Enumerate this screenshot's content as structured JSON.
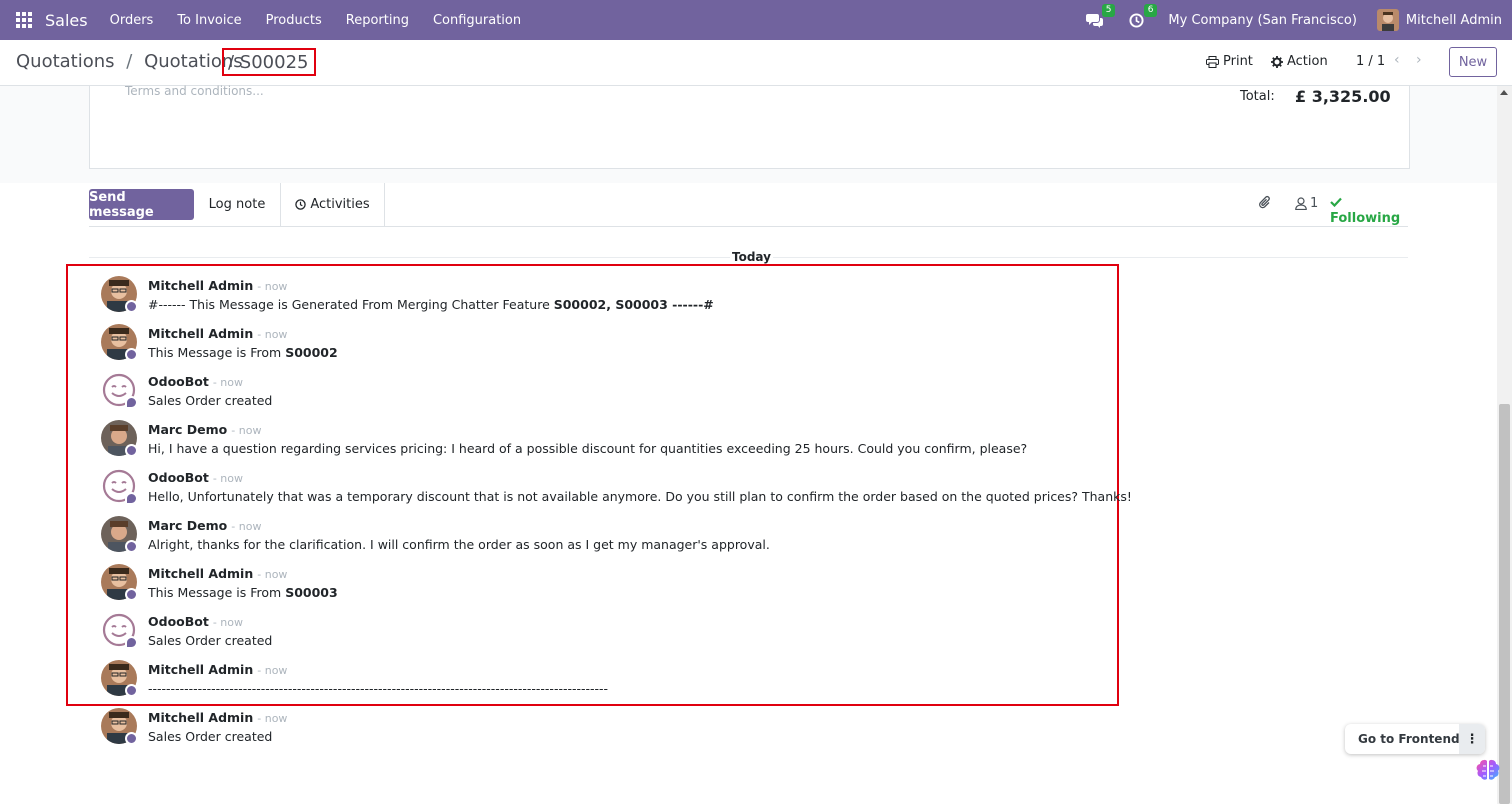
{
  "navbar": {
    "app_name": "Sales",
    "menu": [
      "Orders",
      "To Invoice",
      "Products",
      "Reporting",
      "Configuration"
    ],
    "messages_count": "5",
    "activities_count": "6",
    "company": "My Company (San Francisco)",
    "user": "Mitchell Admin",
    "bg_color": "#71639e"
  },
  "control": {
    "breadcrumb": [
      "Quotations",
      "Quotations"
    ],
    "separator": "/",
    "current": "/ S00025",
    "print": "Print",
    "action": "Action",
    "pager": "1 / 1",
    "new": "New"
  },
  "form": {
    "terms_placeholder": "Terms and conditions...",
    "total_label": "Total:",
    "total_value": "£ 3,325.00"
  },
  "chatter": {
    "send_message": "Send message",
    "log_note": "Log note",
    "activities": "Activities",
    "followers_count": "1",
    "following": "Following",
    "date_separator": "Today",
    "messages": [
      {
        "author": "Mitchell Admin",
        "date": "- now",
        "type": "admin",
        "body_pre": "#------ This Message is Generated From Merging Chatter Feature ",
        "body_bold": "S00002, S00003 ------#",
        "body_post": ""
      },
      {
        "author": "Mitchell Admin",
        "date": "- now",
        "type": "admin",
        "body_pre": "This Message is From ",
        "body_bold": "S00002",
        "body_post": ""
      },
      {
        "author": "OdooBot",
        "date": "- now",
        "type": "bot",
        "body_pre": "Sales Order created",
        "body_bold": "",
        "body_post": ""
      },
      {
        "author": "Marc Demo",
        "date": "- now",
        "type": "demo",
        "body_pre": "Hi, I have a question regarding services pricing: I heard of a possible discount for quantities exceeding 25 hours. Could you confirm, please?",
        "body_bold": "",
        "body_post": ""
      },
      {
        "author": "OdooBot",
        "date": "- now",
        "type": "bot",
        "body_pre": "Hello, Unfortunately that was a temporary discount that is not available anymore. Do you still plan to confirm the order based on the quoted prices? Thanks!",
        "body_bold": "",
        "body_post": ""
      },
      {
        "author": "Marc Demo",
        "date": "- now",
        "type": "demo",
        "body_pre": "Alright, thanks for the clarification. I will confirm the order as soon as I get my manager's approval.",
        "body_bold": "",
        "body_post": ""
      },
      {
        "author": "Mitchell Admin",
        "date": "- now",
        "type": "admin",
        "body_pre": "This Message is From ",
        "body_bold": "S00003",
        "body_post": ""
      },
      {
        "author": "OdooBot",
        "date": "- now",
        "type": "bot",
        "body_pre": "Sales Order created",
        "body_bold": "",
        "body_post": ""
      },
      {
        "author": "Mitchell Admin",
        "date": "- now",
        "type": "admin",
        "body_pre": "------------------------------------------------------------------------------------------------------",
        "body_bold": "",
        "body_post": ""
      },
      {
        "author": "Mitchell Admin",
        "date": "- now",
        "type": "admin",
        "body_pre": "Sales Order created",
        "body_bold": "",
        "body_post": ""
      }
    ]
  },
  "frontend": {
    "label": "Go to Frontend",
    "more": "⋮"
  },
  "icons": {
    "apps": "apps-grid-icon",
    "chat": "chat-icon",
    "clock": "clock-icon",
    "print": "printer-icon",
    "gear": "gear-icon",
    "paperclip": "paperclip-icon",
    "user": "user-icon",
    "check": "check-icon"
  }
}
